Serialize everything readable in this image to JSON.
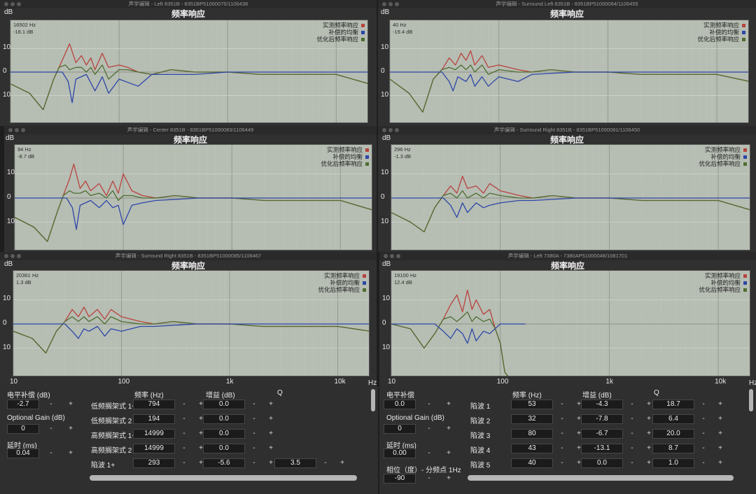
{
  "common": {
    "chart_title": "频率响应",
    "y_unit": "dB",
    "y_ticks": [
      "10",
      "0",
      "10"
    ],
    "x_ticks": [
      "10",
      "100",
      "1k",
      "10k"
    ],
    "x_unit": "Hz",
    "legend": [
      "实测频率响应",
      "补偿的均衡",
      "优化后频率响应"
    ],
    "colors": {
      "measured": "#b8433d",
      "eq": "#2d47a8",
      "optimized": "#4f6e32"
    }
  },
  "windows": [
    {
      "title": "声学编辑 - Left 8351B - 8351BP51000075/1106438",
      "readout_freq": "16502 Hz",
      "readout_level": "-18.1 dB"
    },
    {
      "title": "声学编辑 - Surround Left 8351B - 8351BP51000084/1106455",
      "readout_freq": "40 Hz",
      "readout_level": "-19.4 dB"
    },
    {
      "title": "声学编辑 - Center 8351B - 8351BP51000083/1106449",
      "readout_freq": "94 Hz",
      "readout_level": "-8.7 dB"
    },
    {
      "title": "声学编辑 - Surround Right 8351B - 8351BP51000081/1106450",
      "readout_freq": "296 Hz",
      "readout_level": "-1.3 dB"
    },
    {
      "title": "声学编辑 - Surround Right 8351B - 8351BP51000085/1106467",
      "readout_freq": "20361 Hz",
      "readout_level": "1.3 dB"
    },
    {
      "title": "声学编辑 - Left 7380A - 7380AP51000048/1081701",
      "readout_freq": "19100 Hz",
      "readout_level": "12.4 dB"
    }
  ],
  "left_panel": {
    "level_label": "电平补偿 (dB)",
    "level_value": "-2.7",
    "gain_label": "Optional Gain (dB)",
    "gain_value": "0",
    "delay_label": "延时 (ms)",
    "delay_value": "0.04",
    "h_freq": "频率 (Hz)",
    "h_gain": "增益 (dB)",
    "h_q": "Q",
    "rows": [
      {
        "label": "低频搁架式 1+",
        "freq": "794",
        "gain": "0.0",
        "q": ""
      },
      {
        "label": "低频搁架式 2",
        "freq": "194",
        "gain": "0.0",
        "q": ""
      },
      {
        "label": "高频搁架式 1+",
        "freq": "14999",
        "gain": "0.0",
        "q": ""
      },
      {
        "label": "高频搁架式 2",
        "freq": "14999",
        "gain": "0.0",
        "q": ""
      },
      {
        "label": "陷波 1+",
        "freq": "293",
        "gain": "-5.6",
        "q": "3.5"
      }
    ]
  },
  "right_panel": {
    "level_label": "电平补偿",
    "level_value": "0.0",
    "gain_label": "Optional Gain (dB)",
    "gain_value": "0",
    "delay_label": "延时 (ms)",
    "delay_value": "0.00",
    "phase_label": "相位（度）- 分频点 1Hz",
    "phase_value": "-90",
    "h_freq": "频率 (Hz)",
    "h_gain": "增益 (dB)",
    "h_q": "Q",
    "rows": [
      {
        "label": "陷波 1",
        "freq": "53",
        "gain": "-4.3",
        "q": "18.7"
      },
      {
        "label": "陷波 2",
        "freq": "32",
        "gain": "-7.8",
        "q": "6.4"
      },
      {
        "label": "陷波 3",
        "freq": "80",
        "gain": "-6.7",
        "q": "20.0"
      },
      {
        "label": "陷波 4",
        "freq": "43",
        "gain": "-13.1",
        "q": "8.7"
      },
      {
        "label": "陷波 5",
        "freq": "40",
        "gain": "0.0",
        "q": "1.0"
      }
    ]
  },
  "stepper": {
    "minus": "-",
    "plus": "+"
  },
  "chart_data": [
    {
      "type": "line",
      "title": "频率响应",
      "ylabel": "dB",
      "xlabel": "Hz",
      "x_scale": "log",
      "xlim": [
        10,
        20000
      ],
      "ylim": [
        -22,
        22
      ],
      "series": [
        {
          "name": "实测频率响应",
          "x": [
            10,
            15,
            20,
            25,
            28,
            32,
            35,
            40,
            45,
            50,
            55,
            60,
            70,
            80,
            100,
            120,
            150,
            200,
            300,
            500,
            1000,
            2000,
            5000,
            10000,
            20000
          ],
          "y": [
            -5,
            -9,
            -16,
            -3,
            2,
            8,
            12,
            4,
            7,
            3,
            6,
            1,
            8,
            2,
            3,
            2,
            0,
            -1,
            1,
            0,
            0,
            -1,
            -1,
            -1,
            -5
          ]
        },
        {
          "name": "补偿的均衡",
          "x": [
            10,
            20,
            30,
            34,
            37,
            40,
            50,
            60,
            70,
            80,
            100,
            150,
            200,
            500,
            1000,
            20000
          ],
          "y": [
            0,
            0,
            0,
            -4,
            -13,
            -3,
            -1,
            -8,
            -2,
            -9,
            -3,
            -6,
            -1,
            -1,
            0,
            0
          ]
        },
        {
          "name": "优化后频率响应",
          "x": [
            10,
            15,
            20,
            25,
            28,
            32,
            35,
            40,
            45,
            50,
            55,
            60,
            70,
            80,
            100,
            120,
            150,
            200,
            300,
            500,
            1000,
            2000,
            5000,
            10000,
            20000
          ],
          "y": [
            -5,
            -9,
            -16,
            -3,
            2,
            3,
            1,
            2,
            2,
            0,
            2,
            -1,
            3,
            -3,
            1,
            1,
            0,
            -1,
            1,
            0,
            0,
            -1,
            -1,
            -1,
            -5
          ]
        }
      ]
    },
    {
      "type": "line",
      "title": "频率响应",
      "ylabel": "dB",
      "xlabel": "Hz",
      "x_scale": "log",
      "xlim": [
        10,
        20000
      ],
      "ylim": [
        -22,
        22
      ],
      "series": [
        {
          "name": "实测频率响应",
          "x": [
            10,
            15,
            20,
            25,
            30,
            35,
            40,
            45,
            50,
            55,
            60,
            70,
            80,
            100,
            150,
            200,
            300,
            500,
            1000,
            2000,
            5000,
            10000,
            20000
          ],
          "y": [
            -3,
            -9,
            -17,
            -3,
            1,
            6,
            3,
            8,
            5,
            9,
            3,
            7,
            2,
            3,
            1,
            0,
            1,
            0,
            0,
            -1,
            -1,
            -1,
            -4
          ]
        },
        {
          "name": "补偿的均衡",
          "x": [
            10,
            20,
            30,
            35,
            38,
            42,
            50,
            55,
            60,
            70,
            80,
            100,
            150,
            200,
            500,
            20000
          ],
          "y": [
            0,
            0,
            0,
            -4,
            -8,
            -2,
            -4,
            -1,
            -6,
            -2,
            -6,
            -2,
            -4,
            -1,
            0,
            0
          ]
        },
        {
          "name": "优化后频率响应",
          "x": [
            10,
            15,
            20,
            25,
            30,
            35,
            40,
            45,
            50,
            55,
            60,
            70,
            80,
            100,
            150,
            200,
            300,
            500,
            1000,
            2000,
            5000,
            10000,
            20000
          ],
          "y": [
            -3,
            -9,
            -17,
            -3,
            1,
            2,
            1,
            3,
            1,
            3,
            0,
            3,
            -1,
            1,
            0,
            0,
            1,
            0,
            0,
            -1,
            -1,
            -1,
            -4
          ]
        }
      ]
    },
    {
      "type": "line",
      "title": "频率响应",
      "ylabel": "dB",
      "xlabel": "Hz",
      "x_scale": "log",
      "xlim": [
        10,
        20000
      ],
      "ylim": [
        -22,
        22
      ],
      "series": [
        {
          "name": "实测频率响应",
          "x": [
            10,
            15,
            20,
            25,
            28,
            32,
            35,
            40,
            45,
            50,
            60,
            70,
            80,
            90,
            100,
            120,
            150,
            200,
            300,
            500,
            1000,
            2000,
            5000,
            10000,
            20000
          ],
          "y": [
            -8,
            -12,
            -18,
            -5,
            1,
            8,
            14,
            4,
            7,
            3,
            6,
            1,
            7,
            2,
            10,
            3,
            1,
            0,
            1,
            0,
            0,
            -1,
            -1,
            -1,
            -5
          ]
        },
        {
          "name": "补偿的均衡",
          "x": [
            10,
            20,
            30,
            34,
            37,
            40,
            50,
            60,
            70,
            80,
            90,
            100,
            120,
            150,
            200,
            500,
            1000,
            20000
          ],
          "y": [
            0,
            0,
            0,
            -4,
            -13,
            -3,
            -1,
            -4,
            -1,
            -4,
            -3,
            -11,
            -3,
            -2,
            -1,
            0,
            0,
            0
          ]
        },
        {
          "name": "优化后频率响应",
          "x": [
            10,
            15,
            20,
            25,
            28,
            32,
            35,
            40,
            45,
            50,
            60,
            70,
            80,
            90,
            100,
            120,
            150,
            200,
            300,
            500,
            1000,
            2000,
            5000,
            10000,
            20000
          ],
          "y": [
            -8,
            -12,
            -18,
            -5,
            1,
            3,
            2,
            2,
            3,
            1,
            2,
            0,
            3,
            -1,
            1,
            1,
            0,
            0,
            1,
            0,
            0,
            -1,
            -1,
            -1,
            -5
          ]
        }
      ]
    },
    {
      "type": "line",
      "title": "频率响应",
      "ylabel": "dB",
      "xlabel": "Hz",
      "x_scale": "log",
      "xlim": [
        10,
        20000
      ],
      "ylim": [
        -22,
        22
      ],
      "series": [
        {
          "name": "实测频率响应",
          "x": [
            10,
            15,
            20,
            25,
            30,
            35,
            40,
            45,
            50,
            60,
            70,
            80,
            100,
            150,
            200,
            300,
            500,
            1000,
            2000,
            5000,
            10000,
            20000
          ],
          "y": [
            -6,
            -10,
            -14,
            -4,
            1,
            5,
            2,
            9,
            4,
            5,
            2,
            6,
            3,
            1,
            0,
            1,
            0,
            0,
            -1,
            -1,
            -1,
            -5
          ]
        },
        {
          "name": "补偿的均衡",
          "x": [
            10,
            20,
            30,
            35,
            40,
            45,
            50,
            60,
            70,
            80,
            100,
            150,
            200,
            500,
            20000
          ],
          "y": [
            0,
            0,
            0,
            -3,
            -8,
            -2,
            -6,
            -2,
            -4,
            -3,
            -2,
            -1,
            -1,
            0,
            0
          ]
        },
        {
          "name": "优化后频率响应",
          "x": [
            10,
            15,
            20,
            25,
            30,
            35,
            40,
            45,
            50,
            60,
            70,
            80,
            100,
            150,
            200,
            300,
            500,
            1000,
            2000,
            5000,
            10000,
            20000
          ],
          "y": [
            -6,
            -10,
            -14,
            -4,
            1,
            2,
            0,
            3,
            0,
            2,
            0,
            2,
            1,
            0,
            0,
            1,
            0,
            0,
            -1,
            -1,
            -1,
            -5
          ]
        }
      ]
    },
    {
      "type": "line",
      "title": "频率响应",
      "ylabel": "dB",
      "xlabel": "Hz",
      "x_scale": "log",
      "xlim": [
        10,
        20000
      ],
      "ylim": [
        -22,
        22
      ],
      "series": [
        {
          "name": "实测频率响应",
          "x": [
            10,
            15,
            20,
            25,
            30,
            35,
            40,
            45,
            50,
            60,
            70,
            80,
            100,
            150,
            200,
            300,
            500,
            1000,
            2000,
            5000,
            10000,
            20000
          ],
          "y": [
            -3,
            -6,
            -12,
            -3,
            1,
            6,
            3,
            7,
            3,
            6,
            2,
            6,
            3,
            1,
            0,
            1,
            0,
            0,
            -1,
            -1,
            -1,
            -3
          ]
        },
        {
          "name": "补偿的均衡",
          "x": [
            10,
            20,
            30,
            35,
            40,
            45,
            50,
            60,
            70,
            80,
            100,
            150,
            200,
            500,
            20000
          ],
          "y": [
            0,
            0,
            0,
            -3,
            -6,
            -2,
            -3,
            -1,
            -5,
            -2,
            -3,
            -1,
            -1,
            0,
            0
          ]
        },
        {
          "name": "优化后频率响应",
          "x": [
            10,
            15,
            20,
            25,
            30,
            35,
            40,
            45,
            50,
            60,
            70,
            80,
            100,
            150,
            200,
            300,
            500,
            1000,
            2000,
            5000,
            10000,
            20000
          ],
          "y": [
            -3,
            -6,
            -12,
            -3,
            1,
            3,
            1,
            3,
            1,
            3,
            0,
            3,
            1,
            0,
            0,
            1,
            0,
            0,
            -1,
            -1,
            -1,
            -3
          ]
        }
      ]
    },
    {
      "type": "line",
      "title": "频率响应",
      "ylabel": "dB",
      "xlabel": "Hz",
      "x_scale": "log",
      "xlim": [
        10,
        20000
      ],
      "ylim": [
        -22,
        22
      ],
      "series": [
        {
          "name": "实测频率响应",
          "x": [
            10,
            15,
            20,
            25,
            30,
            35,
            40,
            45,
            50,
            55,
            60,
            70,
            80,
            90,
            100,
            110,
            120
          ],
          "y": [
            0,
            -2,
            -10,
            -4,
            2,
            8,
            12,
            5,
            14,
            6,
            10,
            4,
            6,
            -2,
            -8,
            -20,
            -22
          ]
        },
        {
          "name": "补偿的均衡",
          "x": [
            10,
            20,
            25,
            30,
            35,
            40,
            45,
            50,
            55,
            60,
            70,
            80,
            100,
            150,
            170
          ],
          "y": [
            0,
            0,
            0,
            -3,
            -6,
            -2,
            -4,
            -8,
            -2,
            -7,
            -3,
            -4,
            0,
            0,
            0
          ]
        },
        {
          "name": "优化后频率响应",
          "x": [
            10,
            15,
            20,
            25,
            30,
            35,
            40,
            45,
            50,
            55,
            60,
            70,
            80,
            90,
            100,
            110,
            120
          ],
          "y": [
            0,
            -2,
            -10,
            -4,
            2,
            3,
            1,
            3,
            5,
            1,
            3,
            1,
            2,
            -2,
            -8,
            -20,
            -22
          ]
        }
      ]
    }
  ]
}
